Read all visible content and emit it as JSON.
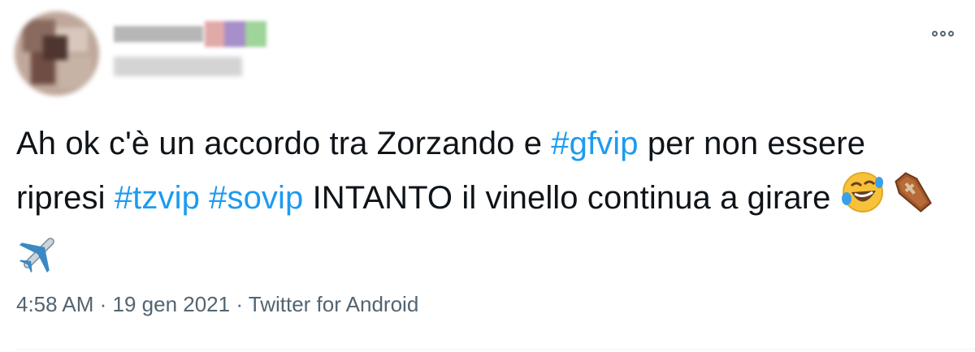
{
  "author": {
    "name": "",
    "handle": ""
  },
  "tweet": {
    "text_1": "Ah ok c'è un accordo tra Zorzando e ",
    "hashtag_1": "#gfvip",
    "text_2": " per non essere ripresi ",
    "hashtag_2": "#tzvip",
    "text_3": " ",
    "hashtag_3": "#sovip",
    "text_4": " INTANTO il vinello continua a girare ",
    "emojis": [
      "rolling-on-floor-laughing-emoji",
      "coffin-emoji",
      "airplane-emoji"
    ]
  },
  "meta": {
    "time": "4:58 AM",
    "separator": " · ",
    "date": "19 gen 2021",
    "source": "Twitter for Android"
  },
  "colors": {
    "hashtag": "#1d9bf0",
    "text": "#0f1419",
    "meta": "#536471"
  },
  "icons": {
    "more": "more-options-icon"
  }
}
